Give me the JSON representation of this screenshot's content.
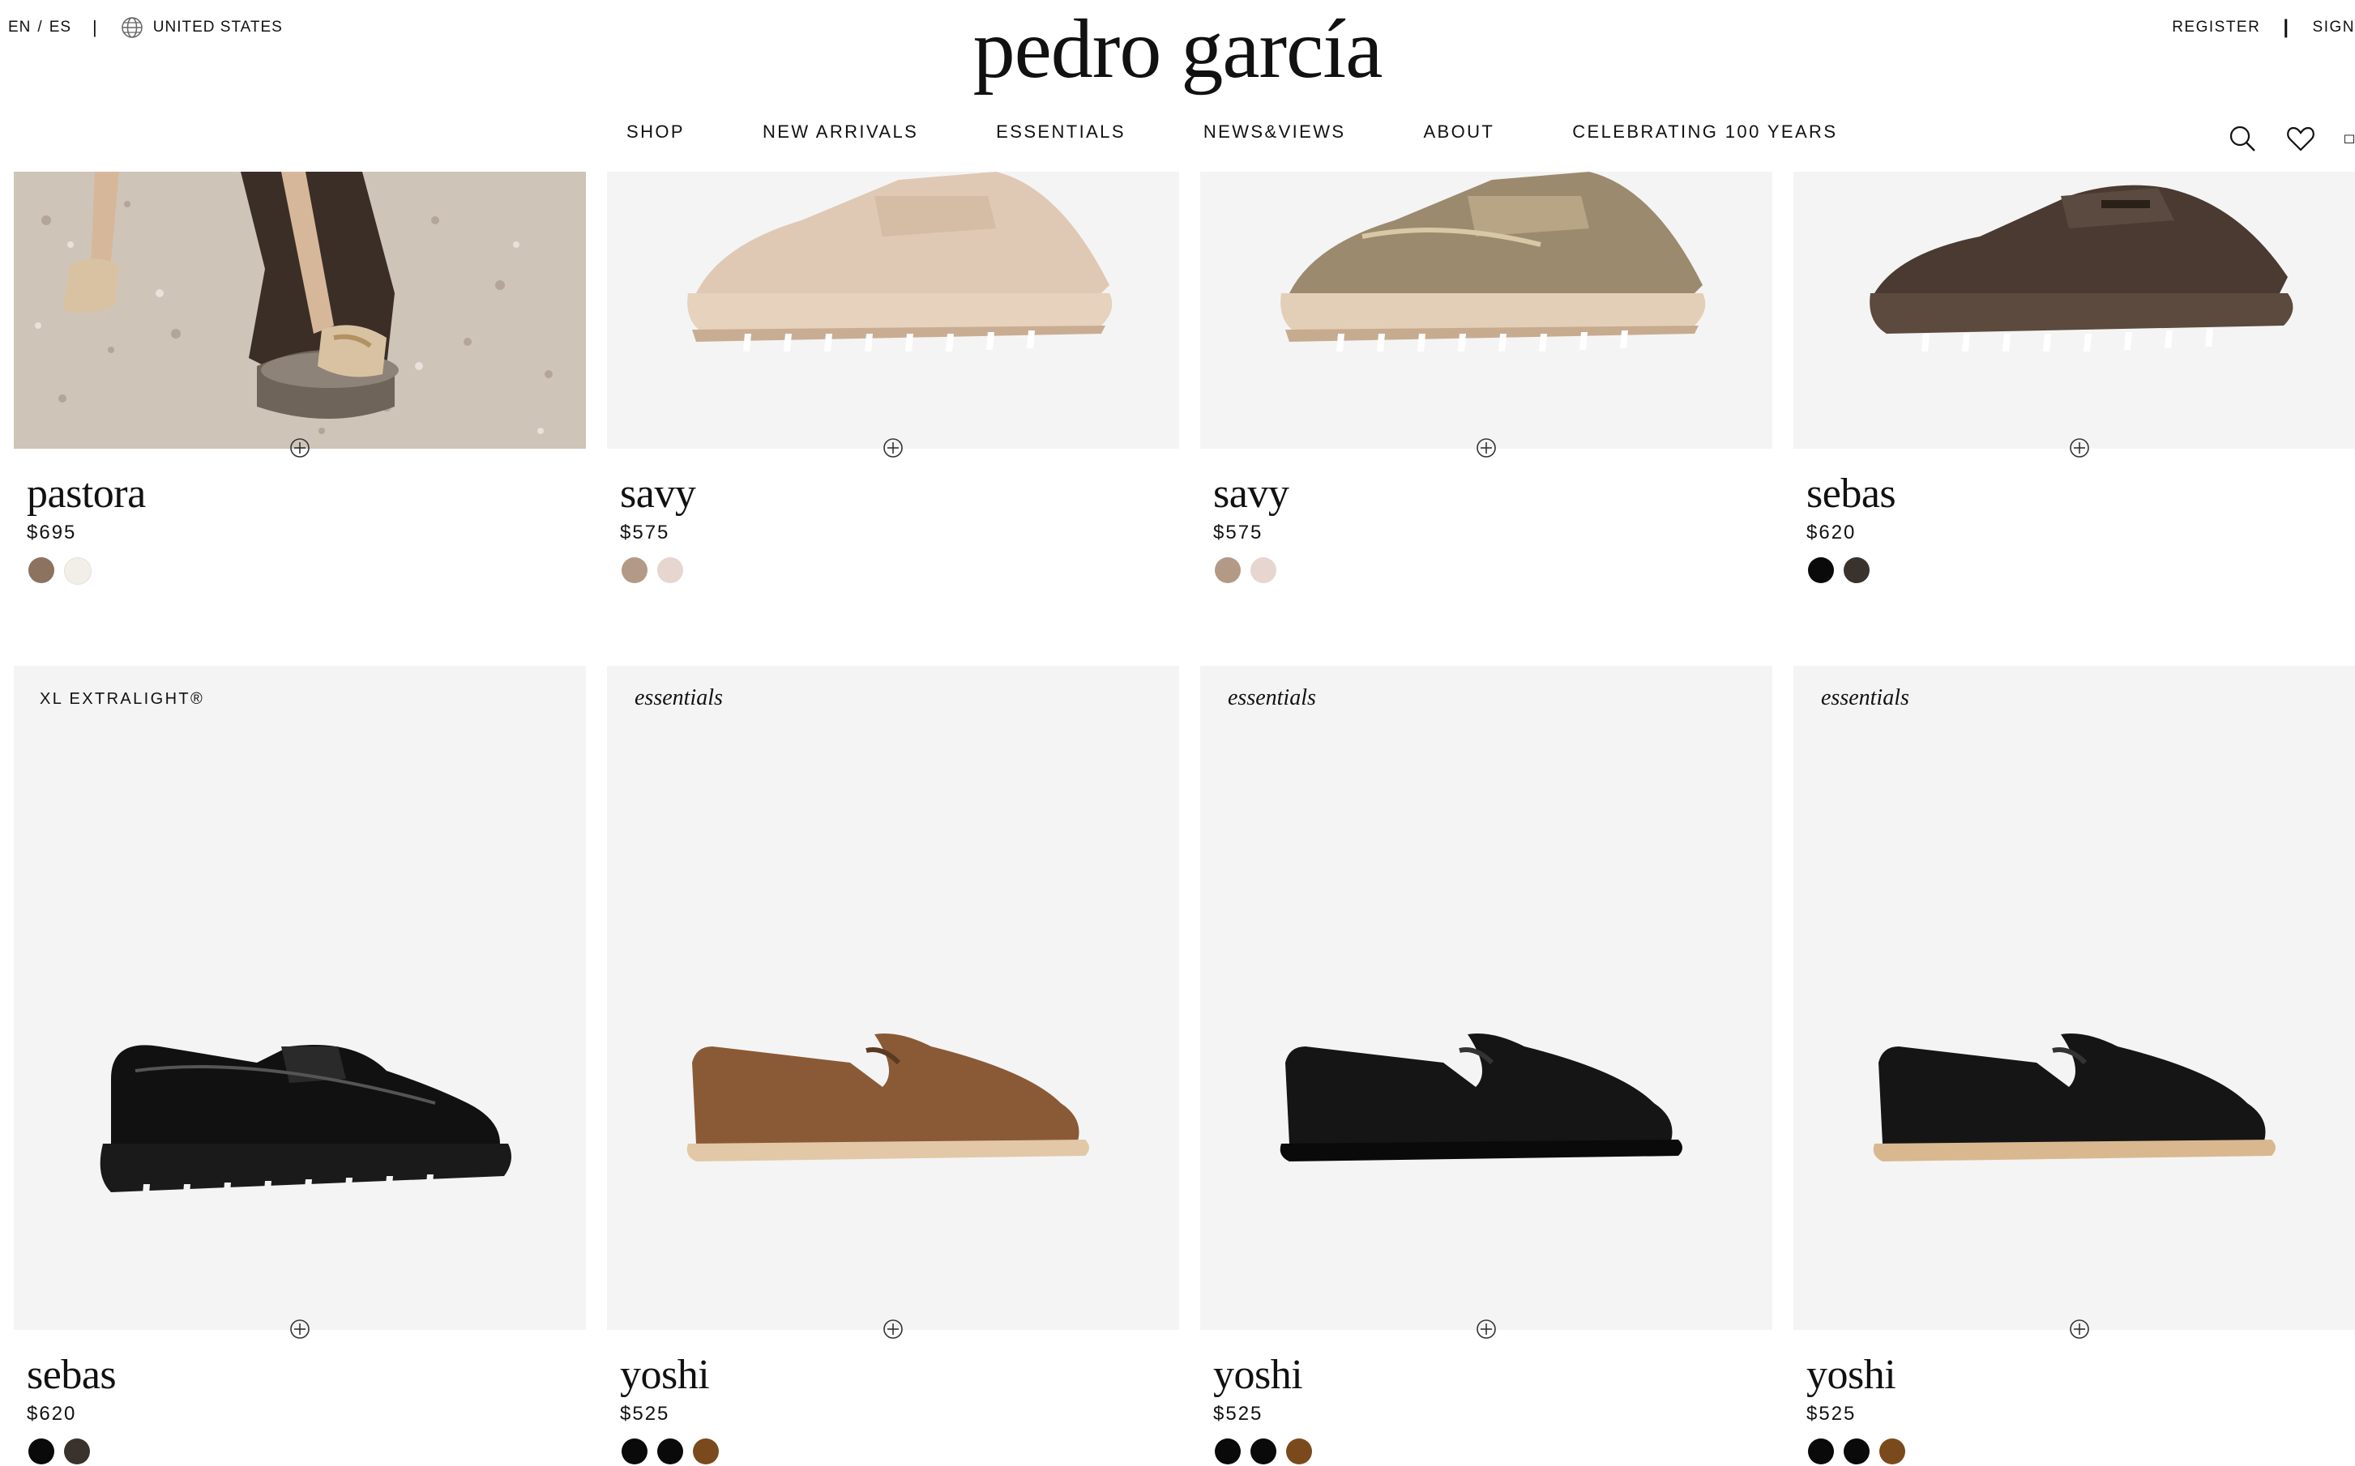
{
  "header": {
    "lang_en": "EN",
    "lang_sep": "/",
    "lang_es": "ES",
    "divider": "|",
    "country": "UNITED STATES",
    "logo": "pedro garcía",
    "register": "REGISTER",
    "account_divider": "|",
    "sign_in": "SIGN"
  },
  "nav": [
    "SHOP",
    "NEW ARRIVALS",
    "ESSENTIALS",
    "NEWS&VIEWS",
    "ABOUT",
    "CELEBRATING 100 YEARS"
  ],
  "header_icons": [
    "search-icon",
    "heart-icon",
    "bag-icon"
  ],
  "products_row1": [
    {
      "name": "pastora",
      "price": "$695",
      "swatches": [
        "#8b7360",
        "#f2efe9"
      ],
      "image": "lifestyle"
    },
    {
      "name": "savy",
      "price": "$575",
      "swatches": [
        "#b39a86",
        "#e6d6cf"
      ],
      "image": "beige-lug-mule"
    },
    {
      "name": "savy",
      "price": "$575",
      "swatches": [
        "#b39a86",
        "#e6d6cf"
      ],
      "image": "metallic-lug-mule"
    },
    {
      "name": "sebas",
      "price": "$620",
      "swatches": [
        "#0a0a0a",
        "#3a322c"
      ],
      "image": "brown-lug-loafer"
    }
  ],
  "products_row2": [
    {
      "name": "sebas",
      "price": "$620",
      "badge": "XL EXTRALIGHT®",
      "swatches": [
        "#0a0a0a",
        "#3a322c"
      ],
      "image": "black-patent-lug-loafer"
    },
    {
      "name": "yoshi",
      "price": "$525",
      "badge": "essentials",
      "swatches": [
        "#0a0a0a",
        "#0a0a0a",
        "#7a4a1d"
      ],
      "image": "brown-suede-slipper"
    },
    {
      "name": "yoshi",
      "price": "$525",
      "badge": "essentials",
      "swatches": [
        "#0a0a0a",
        "#0a0a0a",
        "#7a4a1d"
      ],
      "image": "black-suede-slipper"
    },
    {
      "name": "yoshi",
      "price": "$525",
      "badge": "essentials",
      "swatches": [
        "#0a0a0a",
        "#0a0a0a",
        "#7a4a1d"
      ],
      "image": "black-suede-slipper-natural-sole"
    }
  ]
}
